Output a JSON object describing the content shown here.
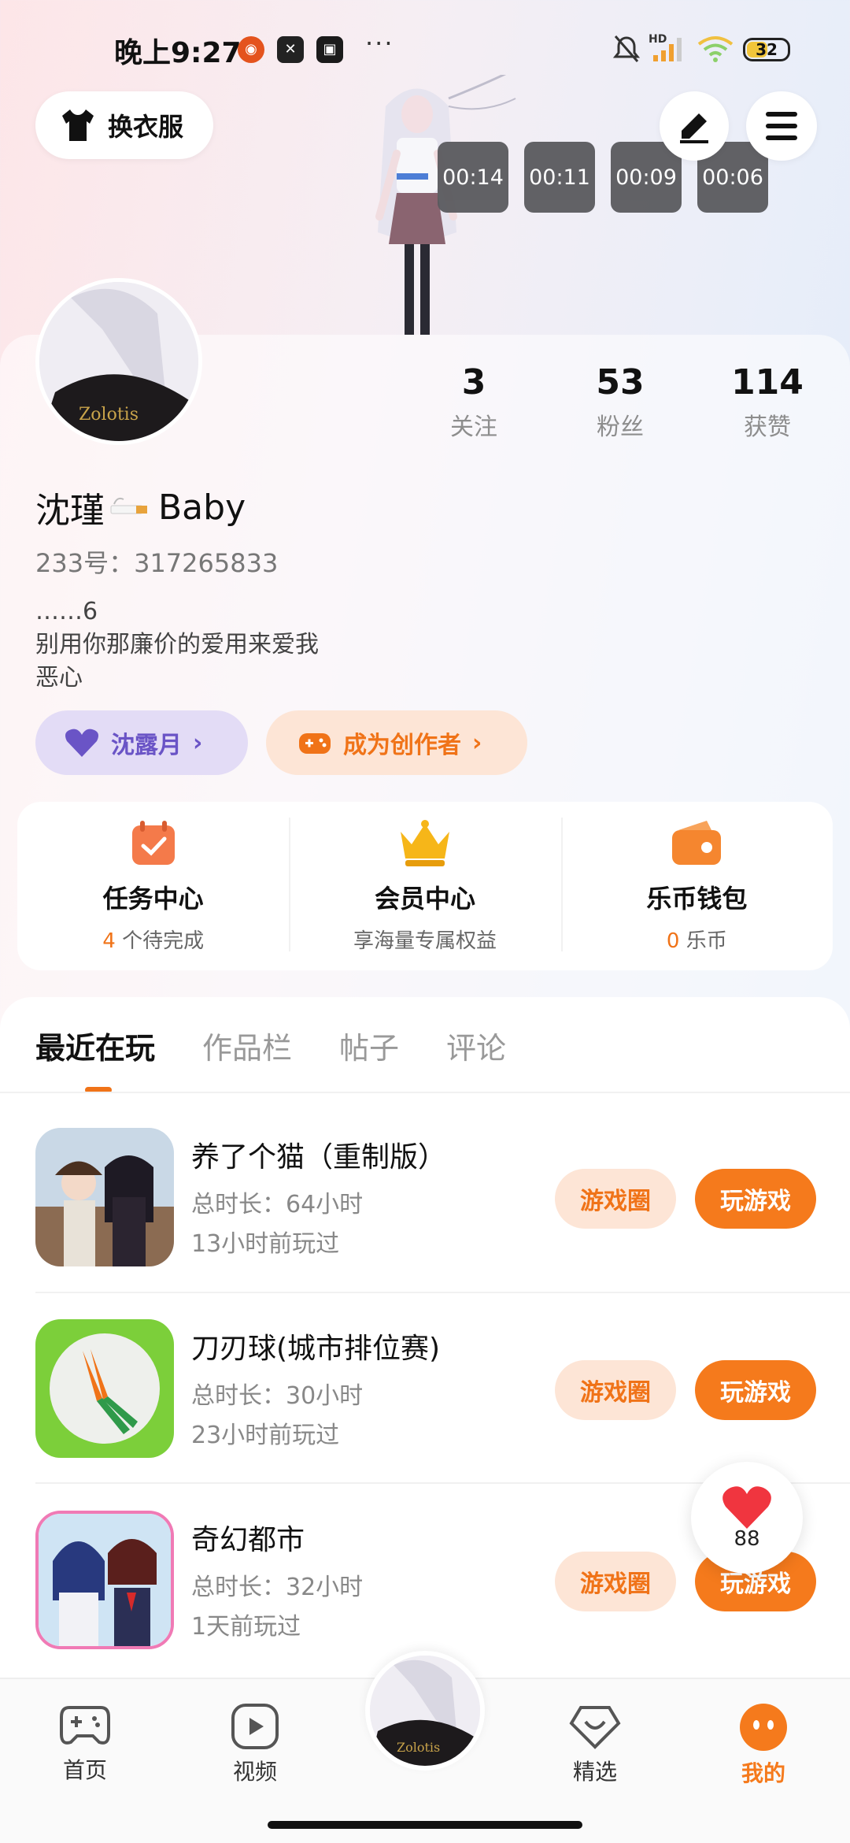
{
  "status": {
    "time": "晚上9:27",
    "more": "···",
    "hd": "HD",
    "battery": "32"
  },
  "header": {
    "outfit_label": "换衣服",
    "edit_icon": "pen-icon",
    "menu_icon": "menu-icon"
  },
  "timers": [
    "00:14",
    "00:11",
    "00:09",
    "00:06"
  ],
  "profile": {
    "stats": [
      {
        "value": "3",
        "label": "关注"
      },
      {
        "value": "53",
        "label": "粉丝"
      },
      {
        "value": "114",
        "label": "获赞"
      }
    ],
    "name_prefix": "沈瑾",
    "name_suffix": "Baby",
    "uid": "233号：317265833",
    "bio": [
      "……6",
      "别用你那廉价的爱用来爱我",
      "恶心"
    ],
    "pill_moon": "沈露月",
    "pill_creator": "成为创作者"
  },
  "quick": [
    {
      "title": "任务中心",
      "count": "4",
      "sub": "个待完成"
    },
    {
      "title": "会员中心",
      "count": "",
      "sub": "享海量专属权益"
    },
    {
      "title": "乐币钱包",
      "count": "0",
      "sub": "乐币"
    }
  ],
  "tabs": [
    "最近在玩",
    "作品栏",
    "帖子",
    "评论"
  ],
  "games": [
    {
      "name": "养了个猫（重制版）",
      "duration": "总时长：64小时",
      "last": "13小时前玩过",
      "circle": "游戏圈",
      "play": "玩游戏"
    },
    {
      "name": "刀刃球(城市排位赛)",
      "duration": "总时长：30小时",
      "last": "23小时前玩过",
      "circle": "游戏圈",
      "play": "玩游戏"
    },
    {
      "name": "奇幻都市",
      "duration": "总时长：32小时",
      "last": "1天前玩过",
      "circle": "游戏圈",
      "play": "玩游戏"
    }
  ],
  "like_count": "88",
  "nav": {
    "home": "首页",
    "video": "视频",
    "featured": "精选",
    "mine": "我的"
  },
  "colors": {
    "accent": "#f57a1c",
    "accent_light": "#fde5d6",
    "moon_pill": "#e3dcf6"
  }
}
